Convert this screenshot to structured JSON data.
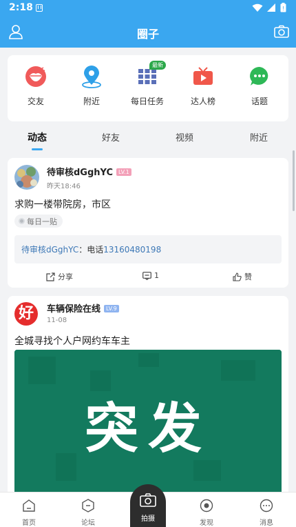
{
  "status": {
    "time": "2:18"
  },
  "header": {
    "title": "圈子"
  },
  "features": [
    {
      "label": "交友",
      "icon": "lips-icon"
    },
    {
      "label": "附近",
      "icon": "location-pin-icon"
    },
    {
      "label": "每日任务",
      "icon": "grid-icon",
      "badge": "最新"
    },
    {
      "label": "达人榜",
      "icon": "tv-icon"
    },
    {
      "label": "话题",
      "icon": "chat-bubble-icon"
    }
  ],
  "tabs": [
    "动态",
    "好友",
    "视频",
    "附近"
  ],
  "posts": [
    {
      "username": "待审核dGghYC",
      "level": "LV.1",
      "time": "昨天18:46",
      "content": "求购一楼带院房，市区",
      "tag": "每日一贴",
      "contact_name": "待审核dGghYC",
      "contact_label": "：电话",
      "contact_phone": "13160480198",
      "share_label": "分享",
      "comment_count": "1",
      "like_label": "赞"
    },
    {
      "username": "车辆保险在线",
      "level": "LV.9",
      "time": "11-08",
      "content": "全城寻找个人户网约车车主",
      "avatar_char": "好",
      "image_text": "突发"
    }
  ],
  "bottom_nav": [
    "首页",
    "论坛",
    "拍摄",
    "发现",
    "消息"
  ],
  "colors": {
    "primary": "#3aa7f0",
    "lv1": "#f3a0b8",
    "lv9": "#8fb4f0",
    "image_bg": "#137a5e"
  }
}
